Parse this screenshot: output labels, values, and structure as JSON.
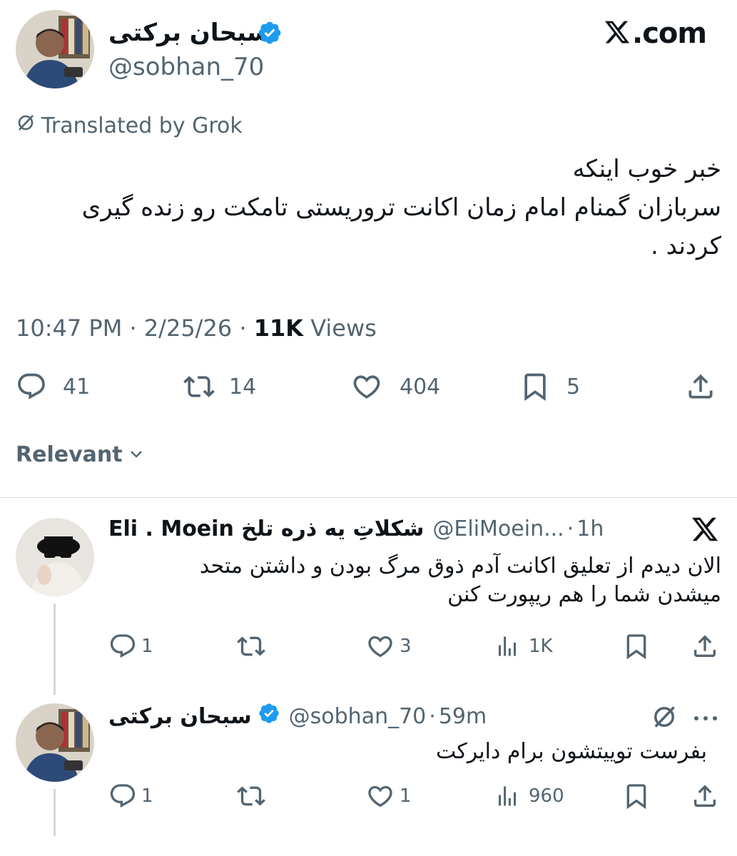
{
  "header": {
    "author_name": "سبحان برکتی",
    "author_handle": "@sobhan_70",
    "site_label": ".com"
  },
  "tweet": {
    "translated_label": "Translated by Grok",
    "text_lines": [
      "خبر خوب اینکه",
      "سربازان گمنام امام زمان اکانت تروریستی تامکت رو زنده گیری",
      "کردند ."
    ],
    "time": "10:47 PM",
    "date": "2/25/26",
    "views_count": "11K",
    "views_label": "Views",
    "replies": "41",
    "retweets": "14",
    "likes": "404",
    "bookmarks": "5"
  },
  "sort": {
    "label": "Relevant"
  },
  "replies": [
    {
      "name": "Eli . Moein شکلاتِ یه ذره تلخ",
      "handle": "@EliMoein...",
      "time": "1h",
      "lines": [
        "الان دیدم از تعلیق اکانت آدم ذوق مرگ بودن  و داشتن متحد",
        "میشدن شما را هم  ریپورت کنن"
      ],
      "replies": "1",
      "retweets": "",
      "likes": "3",
      "views": "1K"
    },
    {
      "name": "سبحان برکتی",
      "handle": "@sobhan_70",
      "time": "59m",
      "lines": [
        "بفرست توییتشون برام دایرکت"
      ],
      "replies": "1",
      "retweets": "",
      "likes": "1",
      "views": "960"
    }
  ],
  "colors": {
    "verified": "#1d9bf0",
    "muted": "#536471",
    "divider": "#cfd9de"
  },
  "icons": [
    "x-logo",
    "verified-badge",
    "translate-icon",
    "reply-icon",
    "retweet-icon",
    "like-icon",
    "bookmark-icon",
    "share-icon",
    "views-icon",
    "more-icon",
    "grok-icon",
    "chevron-down-icon"
  ]
}
